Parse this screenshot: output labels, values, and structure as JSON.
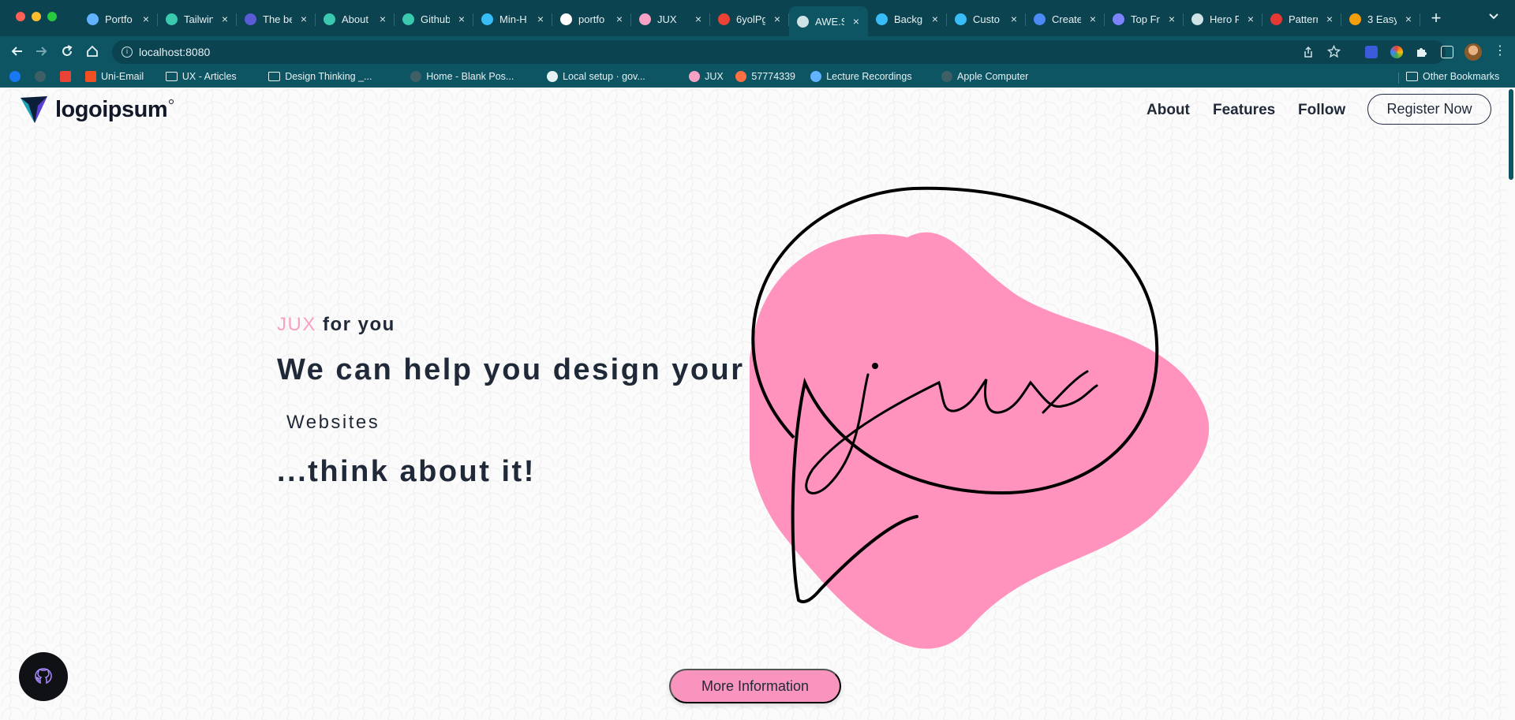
{
  "browser": {
    "tabs": [
      {
        "label": "Portfo",
        "icon": "snowflake-icon",
        "color": "#61b3ff",
        "active": false
      },
      {
        "label": "Tailwin",
        "icon": "leaf-icon",
        "color": "#3bc9b0",
        "active": false
      },
      {
        "label": "The be",
        "icon": "square-icon",
        "color": "#5b5bd6",
        "active": false
      },
      {
        "label": "About",
        "icon": "leaf-icon",
        "color": "#3bc9b0",
        "active": false
      },
      {
        "label": "Github",
        "icon": "leaf-icon",
        "color": "#3bc9b0",
        "active": false
      },
      {
        "label": "Min-H",
        "icon": "tailwind-icon",
        "color": "#38bdf8",
        "active": false
      },
      {
        "label": "portfo",
        "icon": "google-icon",
        "color": "#ffffff",
        "active": false
      },
      {
        "label": "JUX",
        "icon": "speech-bubble-icon",
        "color": "#f7a1c4",
        "active": false
      },
      {
        "label": "6yolPg",
        "icon": "pinwheel-icon",
        "color": "#ea4335",
        "active": false
      },
      {
        "label": "AWE.S",
        "icon": "globe-icon",
        "color": "#cfe2e6",
        "active": true
      },
      {
        "label": "Backg",
        "icon": "tailwind-icon",
        "color": "#38bdf8",
        "active": false
      },
      {
        "label": "Custo",
        "icon": "tailwind-icon",
        "color": "#38bdf8",
        "active": false
      },
      {
        "label": "Create",
        "icon": "circle-c-icon",
        "color": "#4c8bf5",
        "active": false
      },
      {
        "label": "Top Fr",
        "icon": "hat-icon",
        "color": "#7c83fd",
        "active": false
      },
      {
        "label": "Hero P",
        "icon": "globe-icon",
        "color": "#cfe2e6",
        "active": false
      },
      {
        "label": "Pattern",
        "icon": "flag-icon",
        "color": "#e53935",
        "active": false
      },
      {
        "label": "3 Easy",
        "icon": "square-icon",
        "color": "#f59e0b",
        "active": false
      }
    ],
    "close_glyph": "×",
    "new_tab_glyph": "+",
    "url": "localhost:8080",
    "bookmarks": [
      {
        "label": "",
        "icon": "facebook-icon"
      },
      {
        "label": "",
        "icon": "circle-icon"
      },
      {
        "label": "",
        "icon": "gmail-icon"
      },
      {
        "label": "Uni-Email",
        "icon": "microsoft-icon"
      },
      {
        "label": "UX - Articles",
        "icon": "folder-icon"
      },
      {
        "label": "Design Thinking _...",
        "icon": "folder-icon"
      },
      {
        "label": "Home - Blank Pos...",
        "icon": "circle-icon"
      },
      {
        "label": "Local setup · gov...",
        "icon": "github-icon"
      },
      {
        "label": "JUX",
        "icon": "speech-bubble-icon"
      },
      {
        "label": "57774339",
        "icon": "image-icon"
      },
      {
        "label": "Lecture Recordings",
        "icon": "snowflake-icon"
      },
      {
        "label": "Apple Computer",
        "icon": "circle-icon"
      }
    ],
    "other_bookmarks": "Other Bookmarks"
  },
  "site": {
    "logo_text": "logoipsum",
    "nav": [
      "About",
      "Features",
      "Follow"
    ],
    "register_label": "Register Now",
    "hero": {
      "brand": "JUX",
      "tagline_rest": " for you",
      "headline": "We can help you design your",
      "rotating_word": "Websites",
      "closing": "...think about it!",
      "art_script": "jux"
    },
    "more_info_label": "More Information",
    "colors": {
      "accent_pink": "#f894bd",
      "text_dark": "#1f2937",
      "chrome_teal": "#0e5564"
    }
  }
}
